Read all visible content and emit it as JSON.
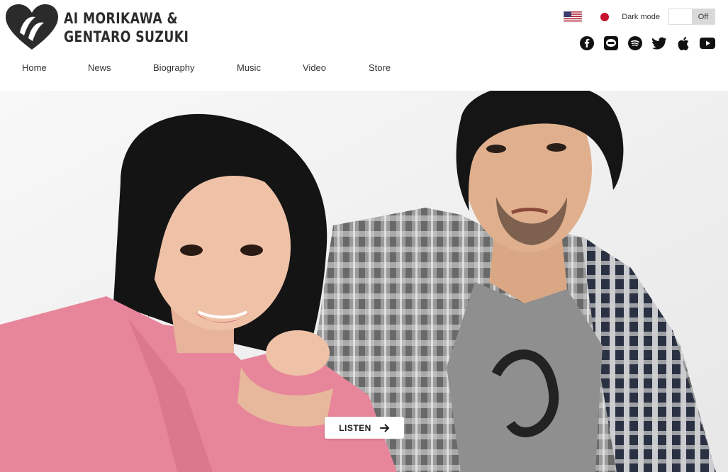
{
  "brand": {
    "line1": "AI MORIKAWA &",
    "line2": "GENTARO SUZUKI"
  },
  "nav": {
    "items": [
      "Home",
      "News",
      "Biography",
      "Music",
      "Video",
      "Store"
    ]
  },
  "language": {
    "options": [
      "English (US flag)",
      "Japanese (JP flag)"
    ]
  },
  "dark_mode": {
    "label": "Dark mode",
    "state": "Off"
  },
  "social_icons": [
    "facebook-icon",
    "line-icon",
    "spotify-icon",
    "twitter-icon",
    "apple-icon",
    "youtube-icon"
  ],
  "hero": {
    "cta_label": "LISTEN"
  },
  "colors": {
    "brand_dark": "#2b2b2b",
    "pink_shirt": "#e7869a",
    "toggle_off_bg": "#d9d9d9",
    "jp_red": "#c8102e"
  }
}
